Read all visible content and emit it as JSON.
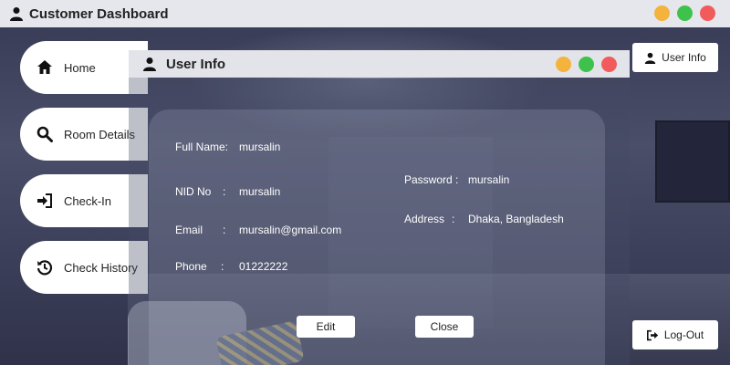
{
  "app": {
    "title": "Customer Dashboard"
  },
  "sidebar": {
    "items": [
      {
        "label": "Home",
        "icon": "home-icon"
      },
      {
        "label": "Room Details",
        "icon": "search-icon"
      },
      {
        "label": "Check-In",
        "icon": "sign-in-icon"
      },
      {
        "label": "Check History",
        "icon": "history-icon"
      }
    ]
  },
  "right_buttons": {
    "user_info": "User Info",
    "logout": "Log-Out"
  },
  "user_info_window": {
    "title": "User Info",
    "fields": {
      "full_name_label": "Full Name:",
      "full_name_value": "mursalin",
      "nid_label": "NID No",
      "nid_colon": ":",
      "nid_value": "mursalin",
      "email_label": "Email",
      "email_colon": ":",
      "email_value": "mursalin@gmail.com",
      "phone_label": "Phone",
      "phone_colon": ":",
      "phone_value": "01222222",
      "password_label": "Password :",
      "password_value": "mursalin",
      "address_label": "Address",
      "address_colon": ":",
      "address_value": "Dhaka, Bangladesh"
    },
    "buttons": {
      "edit": "Edit",
      "close": "Close"
    }
  },
  "colors": {
    "minimize": "#f3b33d",
    "maximize": "#3fc24c",
    "close": "#f25b5b"
  }
}
